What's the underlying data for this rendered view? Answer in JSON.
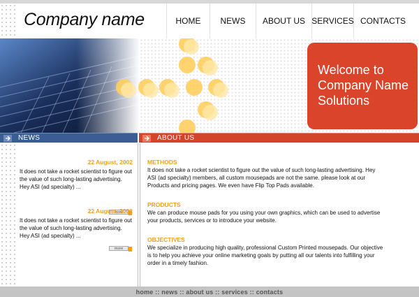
{
  "header": {
    "company_name": "Company name",
    "nav": [
      "HOME",
      "NEWS",
      "ABOUT US",
      "SERVICES",
      "CONTACTS"
    ]
  },
  "banner": {
    "welcome": "Welcome to\nCompany Name\nSolutions",
    "accent_color": "#d9442a",
    "circle_color": "#ffd060"
  },
  "news": {
    "title": "NEWS",
    "items": [
      {
        "date": "22 August, 2002",
        "text": "It does not take a rocket scientist to figure out the value of such long-lasting advertising. Hey ASI (ad specialty) ...",
        "more": "more"
      },
      {
        "date": "22 August, 2002",
        "text": "It does not take a rocket scientist to figure out the value of such long-lasting advertising. Hey ASI (ad specialty) ...",
        "more": "more"
      }
    ]
  },
  "about": {
    "title": "ABOUT US",
    "sections": [
      {
        "heading": "METHODS",
        "text": "It does not take a rocket scientist to figure out the value of such long-lasting advertising. Hey ASI (ad specialty) members, all custom mousepads are not the same. please look at our Products and pricing pages. We even have Flip Top Pads available."
      },
      {
        "heading": "PRODUCTS",
        "text": "We can produce mouse pads for you using your own graphics, which can be used to advertise your products, services or to introduce your website."
      },
      {
        "heading": "OBJECTIVES",
        "text": "We specialize in producing high quality, professional Custom Printed mousepads. Our objective is to help you achieve your online marketing goals by putting all our talents into fulfilling your order in a timely fashion."
      }
    ]
  },
  "footer": {
    "links": "home :: news :: about us :: services :: contacts"
  },
  "colors": {
    "news_bar": "#3a5e94",
    "about_bar": "#d3442a",
    "heading_orange": "#f0a020",
    "footer_bg": "#c4c4c4"
  }
}
